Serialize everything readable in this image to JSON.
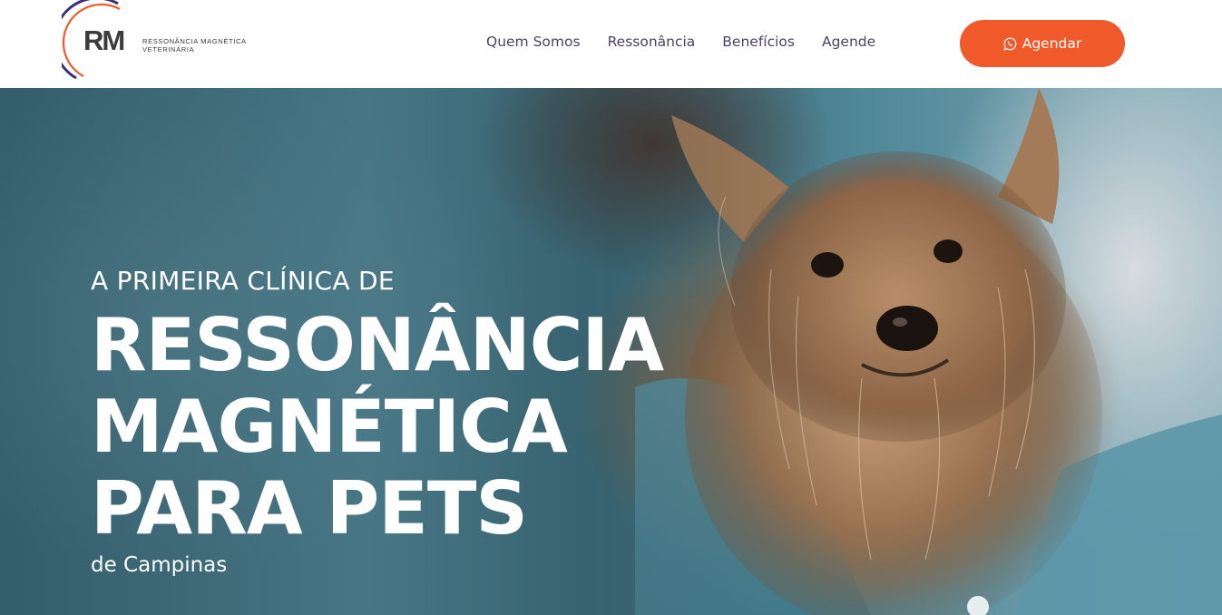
{
  "brand": {
    "logo_mark": "RM",
    "logo_line1": "RESSONÂNCIA MAGNÉTICA",
    "logo_line2": "VETERINÁRIA",
    "accent_color": "#f0592a",
    "nav_color": "#4a4266",
    "logo_arc_colors": [
      "#3d2f73",
      "#f0592a"
    ]
  },
  "nav": {
    "items": [
      {
        "label": "Quem Somos"
      },
      {
        "label": "Ressonância"
      },
      {
        "label": "Benefícios"
      },
      {
        "label": "Agende"
      }
    ]
  },
  "cta": {
    "label": "Agendar",
    "icon": "whatsapp-icon"
  },
  "hero": {
    "eyebrow": "A PRIMEIRA CLÍNICA DE",
    "headline_lines": [
      "RESSONÂNCIA",
      "MAGNÉTICA",
      "PARA PETS"
    ],
    "subline": "de Campinas",
    "image": "veterinarian-holding-yorkshire-terrier"
  }
}
